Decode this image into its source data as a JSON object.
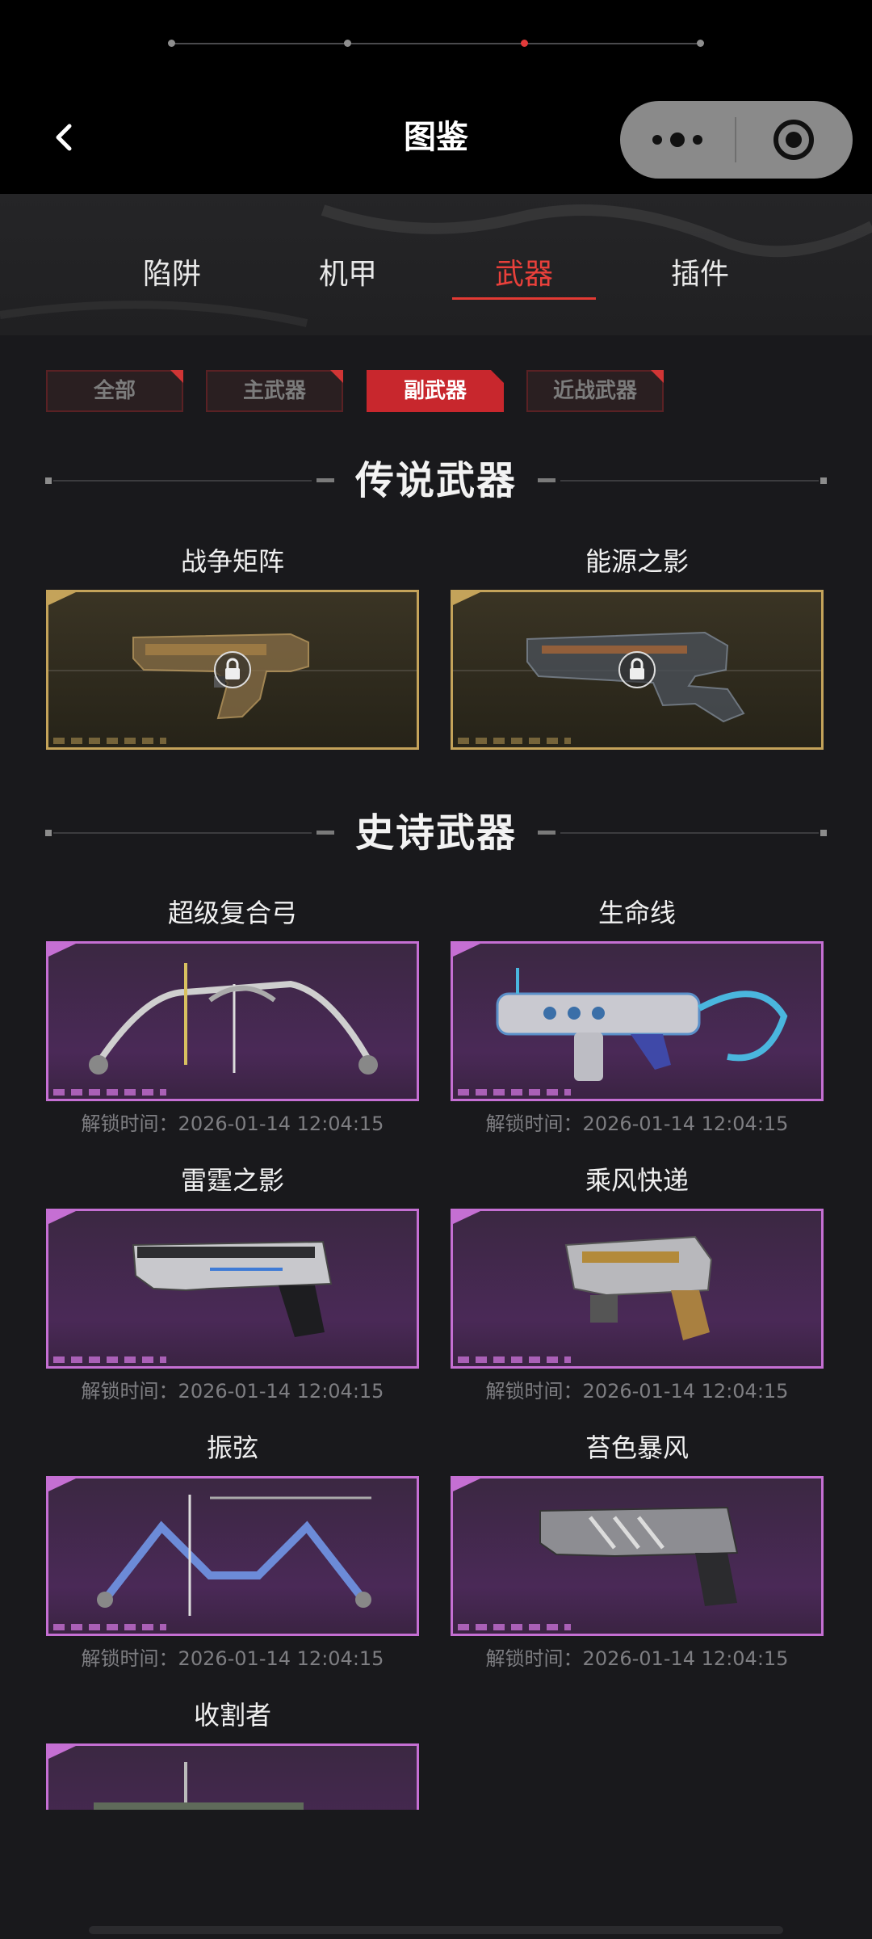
{
  "header": {
    "title": "图鉴"
  },
  "tabs": [
    {
      "label": "陷阱",
      "active": false
    },
    {
      "label": "机甲",
      "active": false
    },
    {
      "label": "武器",
      "active": true
    },
    {
      "label": "插件",
      "active": false
    }
  ],
  "filters": [
    {
      "label": "全部",
      "active": false
    },
    {
      "label": "主武器",
      "active": false
    },
    {
      "label": "副武器",
      "active": true
    },
    {
      "label": "近战武器",
      "active": false
    }
  ],
  "sections": {
    "legendary": {
      "title": "传说武器",
      "items": [
        {
          "name": "战争矩阵",
          "locked": true
        },
        {
          "name": "能源之影",
          "locked": true
        }
      ]
    },
    "epic": {
      "title": "史诗武器",
      "items": [
        {
          "name": "超级复合弓",
          "unlock": "解锁时间：2026-01-14 12:04:15"
        },
        {
          "name": "生命线",
          "unlock": "解锁时间：2026-01-14 12:04:15"
        },
        {
          "name": "雷霆之影",
          "unlock": "解锁时间：2026-01-14 12:04:15"
        },
        {
          "name": "乘风快递",
          "unlock": "解锁时间：2026-01-14 12:04:15"
        },
        {
          "name": "振弦",
          "unlock": "解锁时间：2026-01-14 12:04:15"
        },
        {
          "name": "苔色暴风",
          "unlock": "解锁时间：2026-01-14 12:04:15"
        },
        {
          "name": "收割者"
        }
      ]
    }
  },
  "colors": {
    "accent": "#e8403b",
    "legend_frame": "#c4a35a",
    "epic_frame": "#c56fd3"
  },
  "icons": [
    "back-arrow-icon",
    "more-icon",
    "close-target-icon",
    "lock-icon"
  ]
}
